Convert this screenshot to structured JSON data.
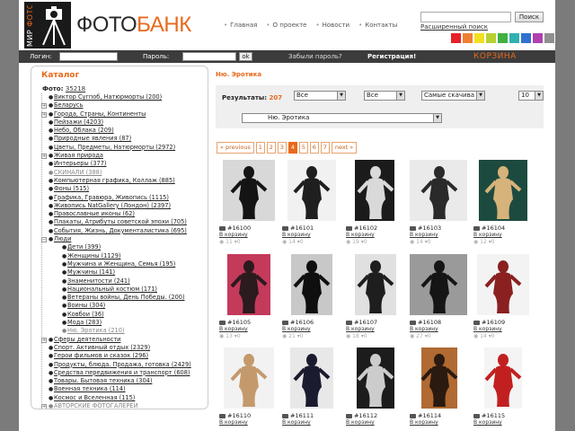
{
  "brand": {
    "logo_vertical_a": "МИР ",
    "logo_vertical_b": "ФОТО",
    "name_a": "ФОТО",
    "name_b": "БАНК"
  },
  "top_nav": [
    "Главная",
    "О проекте",
    "Новости",
    "Контакты"
  ],
  "search": {
    "button": "Поиск",
    "advanced": "Расширенный поиск"
  },
  "color_swatches": [
    "#e8202a",
    "#f08030",
    "#f2e020",
    "#b8d030",
    "#40b040",
    "#30b0b0",
    "#3070d0",
    "#b040b0",
    "#909090",
    "#202020"
  ],
  "login_bar": {
    "login_label": "Логин:",
    "password_label": "Пароль:",
    "ok": "ok",
    "forgot": "Забыли пароль?",
    "register": "Регистрация!",
    "cart": "КОРЗИНА"
  },
  "sidebar": {
    "title": "Каталог",
    "photo_label": "Фото:",
    "photo_count": "35218",
    "items": [
      {
        "label": "Виктор Сугпоб, Натюрморты (200)",
        "level": 0,
        "exp": false
      },
      {
        "label": "Беларусь",
        "level": 0,
        "exp": true
      },
      {
        "label": "Города, Страны, Континенты",
        "level": 0,
        "exp": true
      },
      {
        "label": "Пейзажи (4203)",
        "level": 0,
        "exp": false
      },
      {
        "label": "Небо, Облака (209)",
        "level": 0,
        "exp": false
      },
      {
        "label": "Природные явления (87)",
        "level": 0,
        "exp": false
      },
      {
        "label": "Цветы, Предметы, Натюрморты (2972)",
        "level": 0,
        "exp": false
      },
      {
        "label": "Живая природа",
        "level": 0,
        "exp": true
      },
      {
        "label": "Интерьеры (377)",
        "level": 0,
        "exp": false
      },
      {
        "label": "СКИНАЛИ (388)",
        "level": 0,
        "exp": false,
        "grey": true
      },
      {
        "label": "Компьютерная графика, Коллаж (885)",
        "level": 0,
        "exp": false
      },
      {
        "label": "Фоны (515)",
        "level": 0,
        "exp": false
      },
      {
        "label": "Графика, Гравюра, Живопись (1115)",
        "level": 0,
        "exp": false
      },
      {
        "label": "Живопись NatGallery (Лондон) (2397)",
        "level": 0,
        "exp": false
      },
      {
        "label": "Православные иконы (62)",
        "level": 0,
        "exp": false
      },
      {
        "label": "Плакаты, Атрибуты советской эпохи (705)",
        "level": 0,
        "exp": false
      },
      {
        "label": "События, Жизнь, Документалистика (695)",
        "level": 0,
        "exp": false
      },
      {
        "label": "Люди",
        "level": 0,
        "exp": true,
        "open": true
      },
      {
        "label": "Дети (399)",
        "level": 1
      },
      {
        "label": "Женщины (1129)",
        "level": 1
      },
      {
        "label": "Мужчина и Женщина, Семья (195)",
        "level": 1
      },
      {
        "label": "Мужчины (141)",
        "level": 1
      },
      {
        "label": "Знаменитости (241)",
        "level": 1
      },
      {
        "label": "Национальный костюм (171)",
        "level": 1
      },
      {
        "label": "Ветераны войны, День Победы. (200)",
        "level": 1
      },
      {
        "label": "Воины (304)",
        "level": 1
      },
      {
        "label": "Ковбои (36)",
        "level": 1
      },
      {
        "label": "Мода (283)",
        "level": 1
      },
      {
        "label": "Ню. Эротика (210)",
        "level": 1,
        "grey": true
      },
      {
        "label": "Сферы деятельности",
        "level": 0,
        "exp": true
      },
      {
        "label": "Спорт. Активный отдых (2329)",
        "level": 0,
        "exp": false
      },
      {
        "label": "Герои фильмов и сказок (296)",
        "level": 0,
        "exp": false
      },
      {
        "label": "Продукты, блюда. Продажа, готовка (2429)",
        "level": 0,
        "exp": false
      },
      {
        "label": "Средства передвижения и транспорт (608)",
        "level": 0,
        "exp": false
      },
      {
        "label": "Товары. Бытовая техника (304)",
        "level": 0,
        "exp": false
      },
      {
        "label": "Военная техника (114)",
        "level": 0,
        "exp": false
      },
      {
        "label": "Космос и Вселенная (115)",
        "level": 0,
        "exp": false
      },
      {
        "label": "АВТОРСКИЕ ФОТОГАЛЕРЕИ",
        "level": 0,
        "exp": true,
        "grey": true
      }
    ]
  },
  "main": {
    "section_title": "Ню. Эротика",
    "results_label": "Результаты:",
    "results_count": "207",
    "filters": {
      "f1": "Все",
      "f2": "Все",
      "sort": "Самые скачива",
      "per_page": "10",
      "category": "Ню. Эротика"
    },
    "pager": [
      "« previous",
      "1",
      "2",
      "3",
      "4",
      "5",
      "6",
      "7",
      "next »"
    ],
    "pager_current": "4",
    "basket_label": "В корзину",
    "photos": [
      {
        "id": "#16100",
        "views": "11",
        "dl": "0"
      },
      {
        "id": "#16101",
        "views": "14",
        "dl": "0"
      },
      {
        "id": "#16102",
        "views": "19",
        "dl": "0"
      },
      {
        "id": "#16103",
        "views": "14",
        "dl": "0"
      },
      {
        "id": "#16104",
        "views": "12",
        "dl": "0"
      },
      {
        "id": "#16105",
        "views": "13",
        "dl": "0"
      },
      {
        "id": "#16106",
        "views": "21",
        "dl": "0"
      },
      {
        "id": "#16107",
        "views": "18",
        "dl": "0"
      },
      {
        "id": "#16108",
        "views": "27",
        "dl": "0"
      },
      {
        "id": "#16109",
        "views": "14",
        "dl": "0"
      },
      {
        "id": "#16110",
        "views": "",
        "dl": ""
      },
      {
        "id": "#16111",
        "views": "",
        "dl": ""
      },
      {
        "id": "#16112",
        "views": "",
        "dl": ""
      },
      {
        "id": "#16114",
        "views": "",
        "dl": ""
      },
      {
        "id": "#16115",
        "views": "",
        "dl": ""
      }
    ]
  }
}
